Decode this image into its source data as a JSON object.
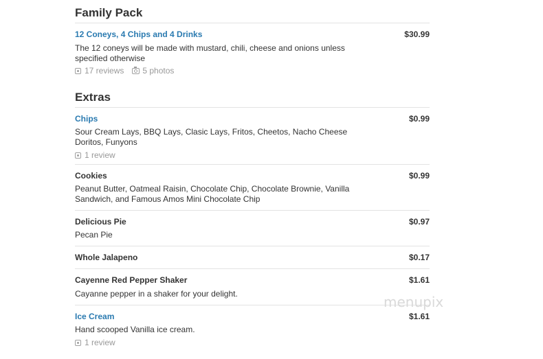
{
  "sections": [
    {
      "title": "Family Pack",
      "items": [
        {
          "name": "12 Coneys, 4 Chips and 4 Drinks",
          "price": "$30.99",
          "description_lines": [
            "The 12 coneys will be made with mustard, chili, cheese and onions unless",
            "specified otherwise"
          ],
          "reviews": "17 reviews",
          "photos": "5 photos"
        }
      ]
    },
    {
      "title": "Extras",
      "items": [
        {
          "name": "Chips",
          "price": "$0.99",
          "description_lines": [
            "Sour Cream Lays, BBQ Lays, Clasic Lays, Fritos, Cheetos, Nacho Cheese",
            "Doritos, Funyons"
          ],
          "reviews": "1 review"
        },
        {
          "name": "Cookies",
          "price": "$0.99",
          "description_lines": [
            "Peanut Butter, Oatmeal Raisin, Chocolate Chip, Chocolate Brownie, Vanilla",
            "Sandwich, and Famous Amos Mini Chocolate Chip"
          ]
        },
        {
          "name": "Delicious Pie",
          "price": "$0.97",
          "description_lines": [
            "Pecan Pie"
          ]
        },
        {
          "name": "Whole Jalapeno",
          "price": "$0.17"
        },
        {
          "name": "Cayenne Red Pepper Shaker",
          "price": "$1.61",
          "description_lines": [
            "Cayanne pepper in a shaker for your delight."
          ]
        },
        {
          "name": "Ice Cream",
          "price": "$1.61",
          "description_lines": [
            "Hand scooped Vanilla ice cream."
          ],
          "reviews": "1 review"
        }
      ]
    }
  ],
  "watermark": "menupix",
  "colors": {
    "link": "#2a7ab0",
    "text": "#333333",
    "muted": "#999999",
    "rule": "#e3e3e3"
  },
  "icons": {
    "review": "review-icon",
    "photo": "camera-icon"
  }
}
